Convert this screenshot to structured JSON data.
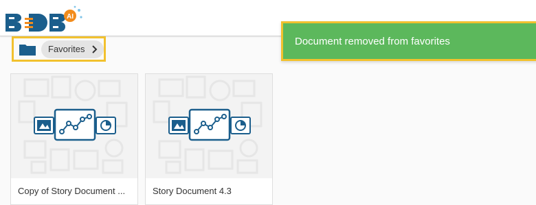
{
  "brand": {
    "logo_letters": "BDB",
    "logo_badge": "AI",
    "primary": "#1b5e8c",
    "accent": "#f28c1c"
  },
  "breadcrumb": {
    "folder_icon": "folder-icon",
    "current": "Favorites",
    "chevron_icon": "chevron-right-icon"
  },
  "toast": {
    "message": "Document removed from favorites",
    "color": "#5cb85c"
  },
  "documents": [
    {
      "title": "Copy of Story Document ...",
      "thumbnail_icon": "story-document-icon"
    },
    {
      "title": "Story Document 4.3",
      "thumbnail_icon": "story-document-icon"
    }
  ]
}
